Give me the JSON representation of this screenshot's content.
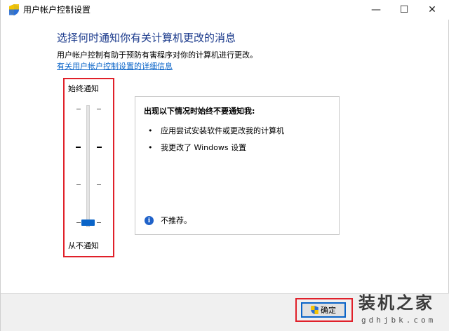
{
  "window": {
    "title": "用户帐户控制设置",
    "minimize_glyph": "—",
    "maximize_glyph": "☐",
    "close_glyph": "✕",
    "title_icon": "uac-shield-icon"
  },
  "main": {
    "heading": "选择何时通知你有关计算机更改的消息",
    "description": "用户帐户控制有助于预防有害程序对你的计算机进行更改。",
    "more_info_link": "有关用户帐户控制设置的详细信息"
  },
  "slider": {
    "top_label": "始终通知",
    "bottom_label": "从不通知",
    "levels": 4,
    "selected_level": 1,
    "accent": "#0a64c8"
  },
  "panel": {
    "title": "出现以下情况时始终不要通知我:",
    "bullets": [
      "应用尝试安装软件或更改我的计算机",
      "我更改了 Windows 设置"
    ],
    "bullet_glyph": "•",
    "note": "不推荐。",
    "note_icon": "info-icon"
  },
  "footer": {
    "ok_label": "确定"
  },
  "watermark": {
    "main": "装机之家",
    "sub": "gdhjbk.com"
  },
  "colors": {
    "highlight_frame": "#e0202a",
    "heading": "#1b3a8c",
    "link": "#0a64c8"
  }
}
